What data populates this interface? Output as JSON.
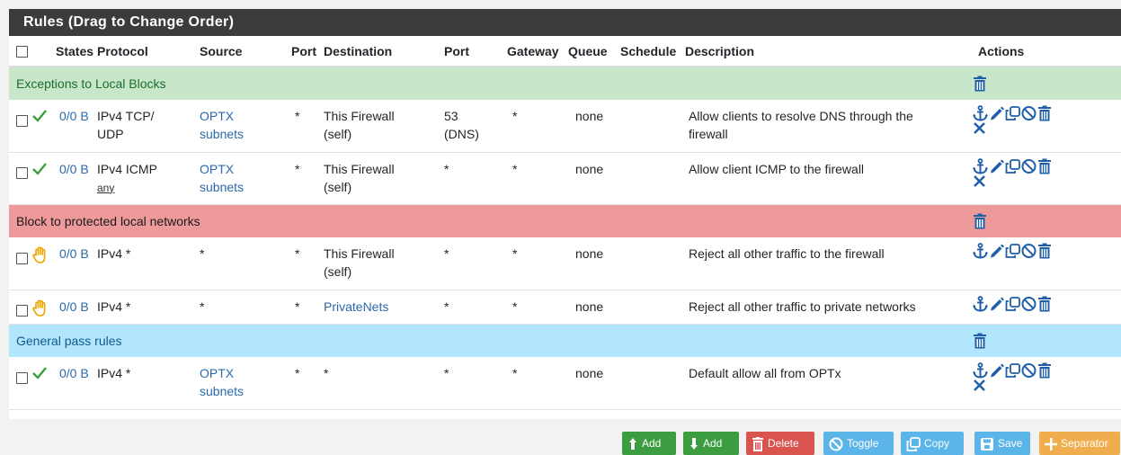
{
  "panel": {
    "title": "Rules (Drag to Change Order)"
  },
  "header": {
    "states": "States",
    "protocol": "Protocol",
    "source": "Source",
    "port": "Port",
    "destination": "Destination",
    "dport": "Port",
    "gateway": "Gateway",
    "queue": "Queue",
    "schedule": "Schedule",
    "description": "Description",
    "actions": "Actions"
  },
  "separators": {
    "s1": "Exceptions to Local Blocks",
    "s2": "Block to protected local networks",
    "s3": "General pass rules"
  },
  "rules": [
    {
      "status": "pass",
      "states": "0/0 B",
      "protocol": "IPv4 TCP/\nUDP",
      "proto_sub": "",
      "source": "OPTX\nsubnets",
      "port": "*",
      "destination": "This Firewall\n(self)",
      "dport": "53\n(DNS)",
      "gateway": "*",
      "queue": "none",
      "schedule": "",
      "description": "Allow clients to resolve DNS through the\nfirewall"
    },
    {
      "status": "pass",
      "states": "0/0 B",
      "protocol": "IPv4 ICMP",
      "proto_sub": "any",
      "source": "OPTX\nsubnets",
      "port": "*",
      "destination": "This Firewall\n(self)",
      "dport": "*",
      "gateway": "*",
      "queue": "none",
      "schedule": "",
      "description": "Allow client ICMP to the firewall"
    },
    {
      "status": "reject",
      "states": "0/0 B",
      "protocol": "IPv4 *",
      "proto_sub": "",
      "source": "*",
      "port": "*",
      "destination": "This Firewall\n(self)",
      "dport": "*",
      "gateway": "*",
      "queue": "none",
      "schedule": "",
      "description": "Reject all other traffic to the firewall"
    },
    {
      "status": "reject",
      "states": "0/0 B",
      "protocol": "IPv4 *",
      "proto_sub": "",
      "source": "*",
      "port": "*",
      "destination": "PrivateNets",
      "dport": "*",
      "gateway": "*",
      "queue": "none",
      "schedule": "",
      "description": "Reject all other traffic to private networks"
    },
    {
      "status": "pass",
      "states": "0/0 B",
      "protocol": "IPv4 *",
      "proto_sub": "",
      "source": "OPTX\nsubnets",
      "port": "*",
      "destination": "*",
      "dport": "*",
      "gateway": "*",
      "queue": "none",
      "schedule": "",
      "description": "Default allow all from OPTx"
    }
  ],
  "buttons": {
    "add_top": "Add",
    "add_bottom": "Add",
    "delete": "Delete",
    "toggle": "Toggle",
    "copy": "Copy",
    "save": "Save",
    "separator": "Separator"
  },
  "colors": {
    "header_bg": "#3c3c3c",
    "sep_green": "#c8e6c9",
    "sep_red": "#ef9a9a",
    "sep_blue": "#b3e5fc",
    "link": "#2a6aab",
    "icon_blue": "#1f5fa8"
  },
  "icons": {
    "pass": "checkmark-icon",
    "reject": "hand-icon",
    "row_actions": [
      "anchor-icon",
      "pencil-icon",
      "copy-icon",
      "disable-icon",
      "trash-icon",
      "times-icon"
    ]
  }
}
